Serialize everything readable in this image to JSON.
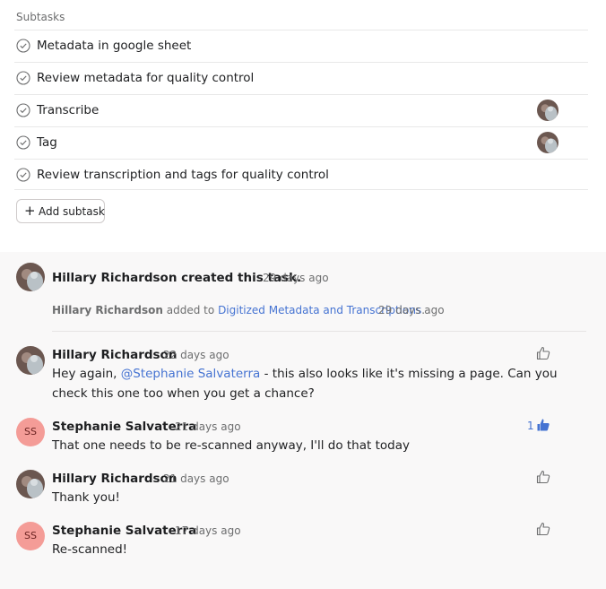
{
  "subtasks": {
    "header": "Subtasks",
    "items": [
      {
        "label": "Metadata in google sheet",
        "assignee": false
      },
      {
        "label": "Review metadata for quality control",
        "assignee": false
      },
      {
        "label": "Transcribe",
        "assignee": true
      },
      {
        "label": "Tag",
        "assignee": true
      },
      {
        "label": "Review transcription and tags for quality control",
        "assignee": false
      }
    ],
    "add_button": "Add subtask"
  },
  "activity": {
    "created": {
      "author": "Hillary Richardson",
      "action": "created this task.",
      "time": "29 days ago"
    },
    "added": {
      "author": "Hillary Richardson",
      "action": "added to",
      "project": "Digitized Metadata and Transcriptions",
      "period": ".",
      "time": "29 days ago"
    }
  },
  "comments": [
    {
      "author": "Hillary Richardson",
      "time": "22 days ago",
      "text_before": "Hey again,",
      "mention": "@Stephanie Salvaterra",
      "text_after": "- this also looks like it's missing a page. Can you check this one too when you get a chance?",
      "likes": ""
    },
    {
      "author": "Stephanie Salvaterra",
      "initials": "SS",
      "time": "21 days ago",
      "text": "That one needs to be re-scanned anyway, I'll do that today",
      "likes": "1"
    },
    {
      "author": "Hillary Richardson",
      "time": "21 days ago",
      "text": "Thank you!",
      "likes": ""
    },
    {
      "author": "Stephanie Salvaterra",
      "initials": "SS",
      "time": "17 days ago",
      "text": "Re-scanned!",
      "likes": ""
    }
  ],
  "colors": {
    "link": "#4573d2",
    "feed_background": "#f9f8f8",
    "initials_avatar": "#f49c97"
  },
  "icons": {
    "subtask_check": "check-circle-icon",
    "add": "plus-icon",
    "like": "thumbs-up-icon"
  }
}
